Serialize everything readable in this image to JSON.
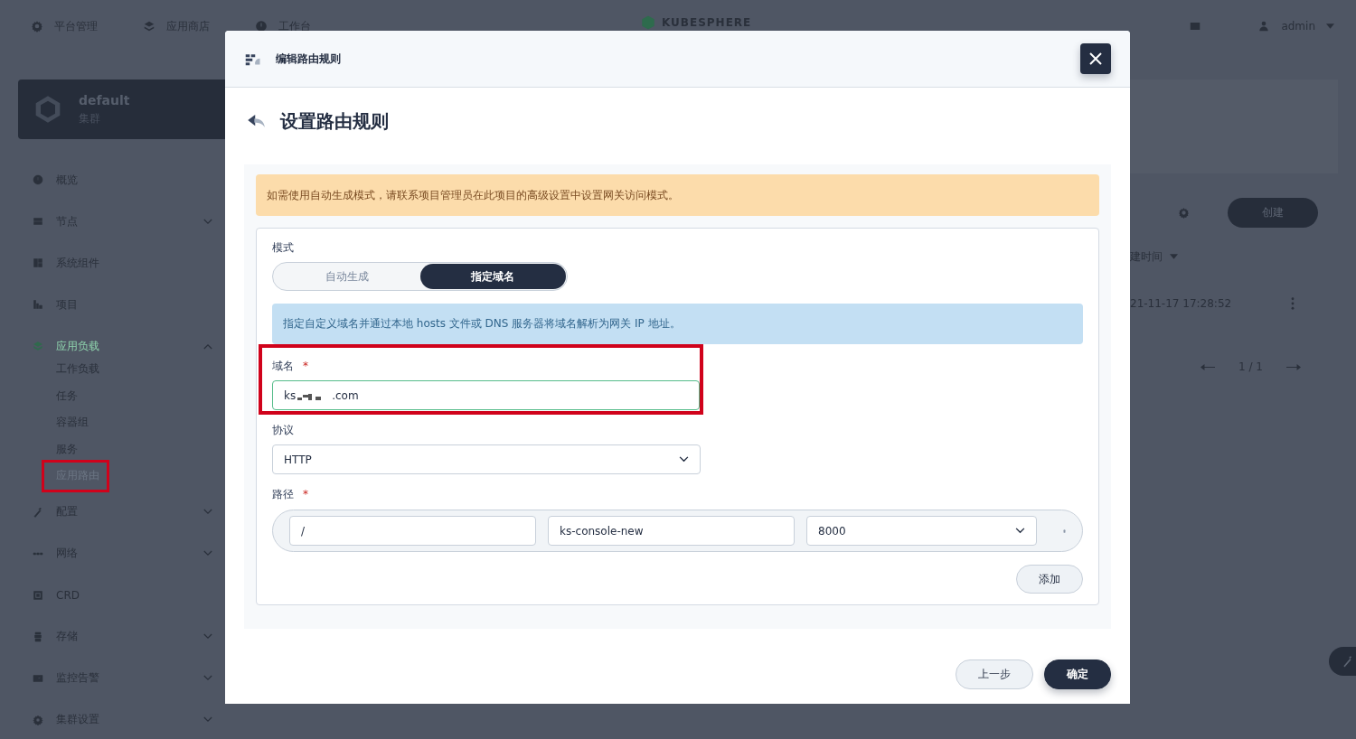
{
  "top_nav": {
    "items": [
      {
        "label": "平台管理"
      },
      {
        "label": "应用商店"
      },
      {
        "label": "工作台"
      }
    ],
    "logo": "KUBESPHERE",
    "user": "admin"
  },
  "cluster": {
    "name": "default",
    "type": "集群"
  },
  "sidebar": {
    "items": [
      {
        "label": "概览"
      },
      {
        "label": "节点",
        "expanded": false
      },
      {
        "label": "系统组件"
      },
      {
        "label": "项目"
      },
      {
        "label": "应用负载",
        "expanded": true,
        "children": [
          {
            "label": "工作负载",
            "selected": false
          },
          {
            "label": "任务",
            "selected": false
          },
          {
            "label": "容器组",
            "selected": false
          },
          {
            "label": "服务",
            "selected": false
          },
          {
            "label": "应用路由",
            "selected": true
          }
        ]
      },
      {
        "label": "配置",
        "expanded": false
      },
      {
        "label": "网络",
        "expanded": false
      },
      {
        "label": "CRD"
      },
      {
        "label": "存储",
        "expanded": false
      },
      {
        "label": "监控告警",
        "expanded": false
      },
      {
        "label": "集群设置",
        "expanded": false
      }
    ]
  },
  "background_list": {
    "create_button": "创建",
    "sort_column": "建时间",
    "row_time": "21-11-17 17:28:52",
    "pagination": "1 / 1"
  },
  "dialog": {
    "title": "编辑路由规则",
    "heading": "设置路由规则",
    "warning": "如需使用自动生成模式，请联系项目管理员在此项目的高级设置中设置网关访问模式。",
    "mode_label": "模式",
    "modes": [
      {
        "label": "自动生成",
        "selected": false
      },
      {
        "label": "指定域名",
        "selected": true
      }
    ],
    "info": "指定自定义域名并通过本地 hosts 文件或 DNS 服务器将域名解析为网关 IP 地址。",
    "domain_label": "域名",
    "domain_required_mark": "*",
    "domain_value_start": "ks",
    "domain_value_end": ".com",
    "protocol_label": "协议",
    "protocol": "HTTP",
    "path_label": "路径",
    "path_required_mark": "*",
    "paths": [
      {
        "path": "/",
        "service": "ks-console-new",
        "port": "8000"
      }
    ],
    "add_button": "添加",
    "back_button": "上一步",
    "confirm_button": "确定"
  }
}
